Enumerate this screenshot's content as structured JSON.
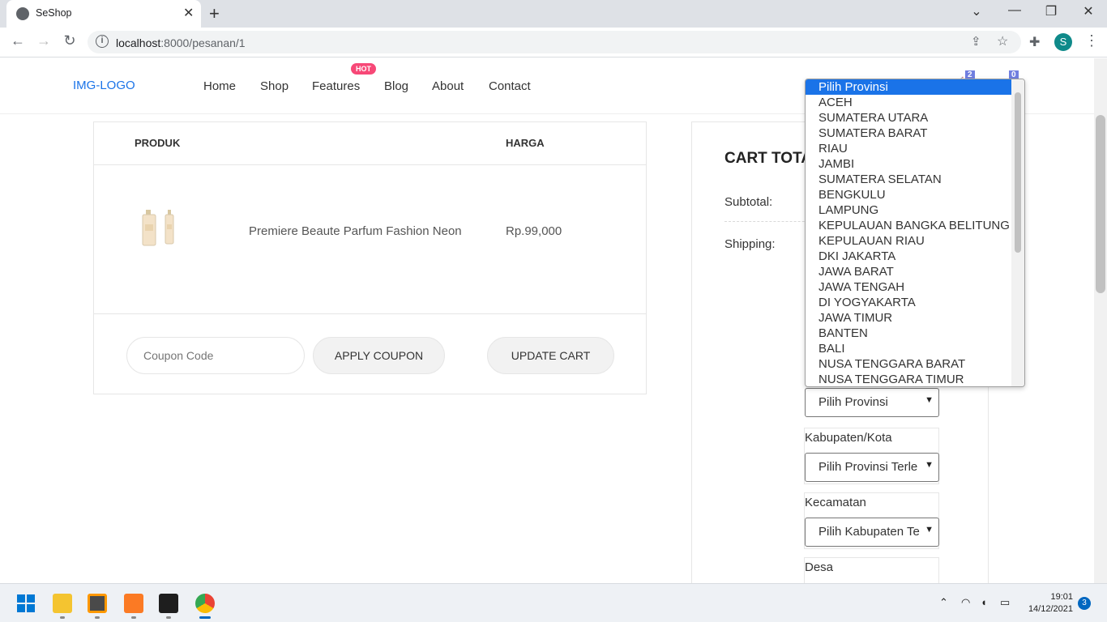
{
  "browser": {
    "tab_title": "SeShop",
    "url_host": "localhost",
    "url_path": ":8000/pesanan/1",
    "profile_initial": "S"
  },
  "header": {
    "logo_alt": "IMG-LOGO",
    "nav": [
      "Home",
      "Shop",
      "Features",
      "Blog",
      "About",
      "Contact"
    ],
    "hot_badge": "HOT",
    "cart_count": "2",
    "wishlist_count": "0"
  },
  "cart": {
    "col_product": "PRODUK",
    "col_price": "HARGA",
    "item_name": "Premiere Beaute Parfum Fashion Neon",
    "item_price": "Rp.99,000",
    "coupon_placeholder": "Coupon Code",
    "apply_coupon": "APPLY COUPON",
    "update_cart": "UPDATE CART"
  },
  "totals": {
    "title": "CART TOTA",
    "subtotal_label": "Subtotal:",
    "shipping_label": "Shipping:",
    "provinsi_select": "Pilih Provinsi",
    "kabupaten_label": "Kabupaten/Kota",
    "kabupaten_select": "Pilih Provinsi Terle",
    "kecamatan_label": "Kecamatan",
    "kecamatan_select": "Pilih Kabupaten Te",
    "desa_label": "Desa"
  },
  "dropdown": {
    "options": [
      "Pilih Provinsi",
      "ACEH",
      "SUMATERA UTARA",
      "SUMATERA BARAT",
      "RIAU",
      "JAMBI",
      "SUMATERA SELATAN",
      "BENGKULU",
      "LAMPUNG",
      "KEPULAUAN BANGKA BELITUNG",
      "KEPULAUAN RIAU",
      "DKI JAKARTA",
      "JAWA BARAT",
      "JAWA TENGAH",
      "DI YOGYAKARTA",
      "JAWA TIMUR",
      "BANTEN",
      "BALI",
      "NUSA TENGGARA BARAT",
      "NUSA TENGGARA TIMUR"
    ],
    "selected_index": 0
  },
  "taskbar": {
    "time": "19:01",
    "date": "14/12/2021",
    "notifications": "3"
  },
  "colors": {
    "accent": "#717fe0",
    "hot": "#f74877",
    "selection": "#1a73e8"
  }
}
